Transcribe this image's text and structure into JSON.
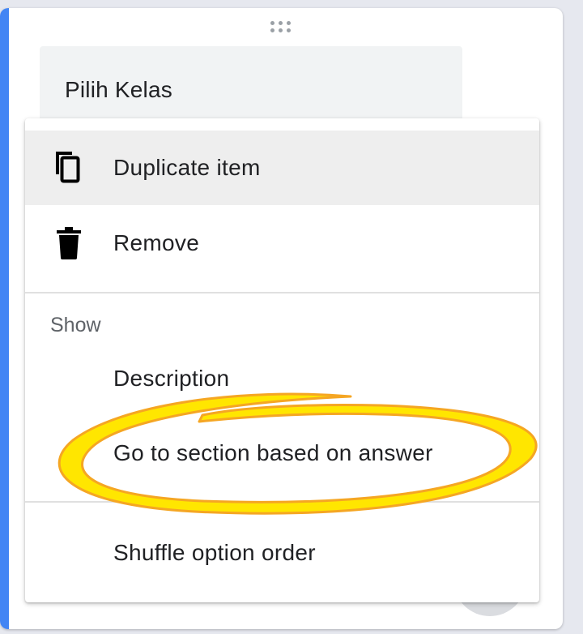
{
  "question": {
    "title": "Pilih Kelas"
  },
  "menu": {
    "actions": [
      {
        "label": "Duplicate item",
        "icon": "copy-icon"
      },
      {
        "label": "Remove",
        "icon": "trash-icon"
      }
    ],
    "show_section": {
      "header": "Show",
      "options": [
        {
          "label": "Description"
        },
        {
          "label": "Go to section based on answer",
          "annotated": true
        }
      ]
    },
    "extra_options": [
      {
        "label": "Shuffle option order"
      }
    ]
  },
  "colors": {
    "accent": "#4285f4",
    "highlight_annotation": "#ffe600",
    "highlight_outline": "#f5a623"
  }
}
